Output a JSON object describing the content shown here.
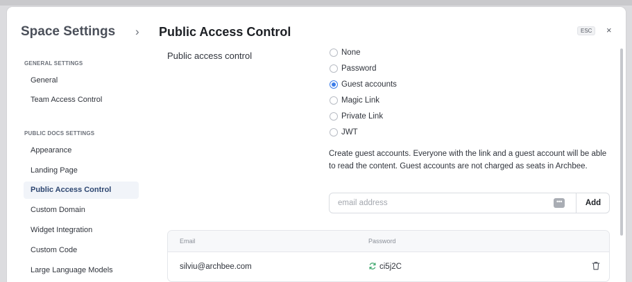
{
  "sidebar": {
    "title": "Space Settings",
    "sections": [
      {
        "label": "GENERAL SETTINGS",
        "items": [
          {
            "label": "General"
          },
          {
            "label": "Team Access Control"
          }
        ]
      },
      {
        "label": "PUBLIC DOCS SETTINGS",
        "items": [
          {
            "label": "Appearance"
          },
          {
            "label": "Landing Page"
          },
          {
            "label": "Public Access Control",
            "active": true
          },
          {
            "label": "Custom Domain"
          },
          {
            "label": "Widget Integration"
          },
          {
            "label": "Custom Code"
          },
          {
            "label": "Large Language Models"
          }
        ]
      }
    ]
  },
  "header": {
    "title": "Public Access Control",
    "esc_label": "ESC",
    "close_glyph": "×"
  },
  "access": {
    "label": "Public access control",
    "options": [
      {
        "label": "None",
        "checked": false
      },
      {
        "label": "Password",
        "checked": false
      },
      {
        "label": "Guest accounts",
        "checked": true
      },
      {
        "label": "Magic Link",
        "checked": false
      },
      {
        "label": "Private Link",
        "checked": false
      },
      {
        "label": "JWT",
        "checked": false
      }
    ],
    "description": "Create guest accounts. Everyone with the link and a guest account will be able to read the content. Guest accounts are not charged as seats in Archbee."
  },
  "guest_form": {
    "email_placeholder": "email address",
    "email_value": "",
    "add_label": "Add"
  },
  "guest_table": {
    "columns": [
      "Email",
      "Password"
    ],
    "rows": [
      {
        "email": "silviu@archbee.com",
        "password": "ci5j2C"
      }
    ]
  },
  "colors": {
    "accent": "#3b7ce9",
    "active_nav_bg": "#f1f4f9",
    "refresh_icon": "#3aa66a"
  }
}
